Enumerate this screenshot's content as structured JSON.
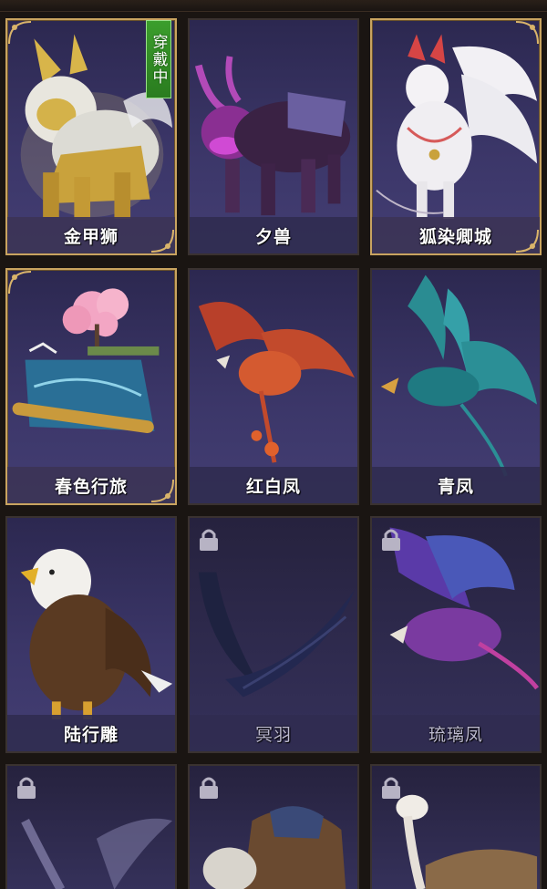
{
  "badge_wearing": "穿戴中",
  "mounts": [
    {
      "name": "金甲狮",
      "locked": false,
      "equipped": true,
      "frame": "gold"
    },
    {
      "name": "夕兽",
      "locked": false,
      "equipped": false,
      "frame": "plain"
    },
    {
      "name": "狐染卿城",
      "locked": false,
      "equipped": false,
      "frame": "gold"
    },
    {
      "name": "春色行旅",
      "locked": false,
      "equipped": false,
      "frame": "gold"
    },
    {
      "name": "红白凤",
      "locked": false,
      "equipped": false,
      "frame": "plain"
    },
    {
      "name": "青凤",
      "locked": false,
      "equipped": false,
      "frame": "plain"
    },
    {
      "name": "陆行雕",
      "locked": false,
      "equipped": false,
      "frame": "plain"
    },
    {
      "name": "冥羽",
      "locked": true,
      "equipped": false,
      "frame": "plain"
    },
    {
      "name": "琉璃凤",
      "locked": true,
      "equipped": false,
      "frame": "plain"
    },
    {
      "name": "",
      "locked": true,
      "equipped": false,
      "frame": "plain"
    },
    {
      "name": "",
      "locked": true,
      "equipped": false,
      "frame": "plain"
    },
    {
      "name": "",
      "locked": true,
      "equipped": false,
      "frame": "plain"
    }
  ],
  "colors": {
    "gold_frame": "#c9a460",
    "badge_green": "#3b9e2c",
    "card_bg": "#3b3668"
  },
  "icons": {
    "lock": "padlock-icon"
  }
}
